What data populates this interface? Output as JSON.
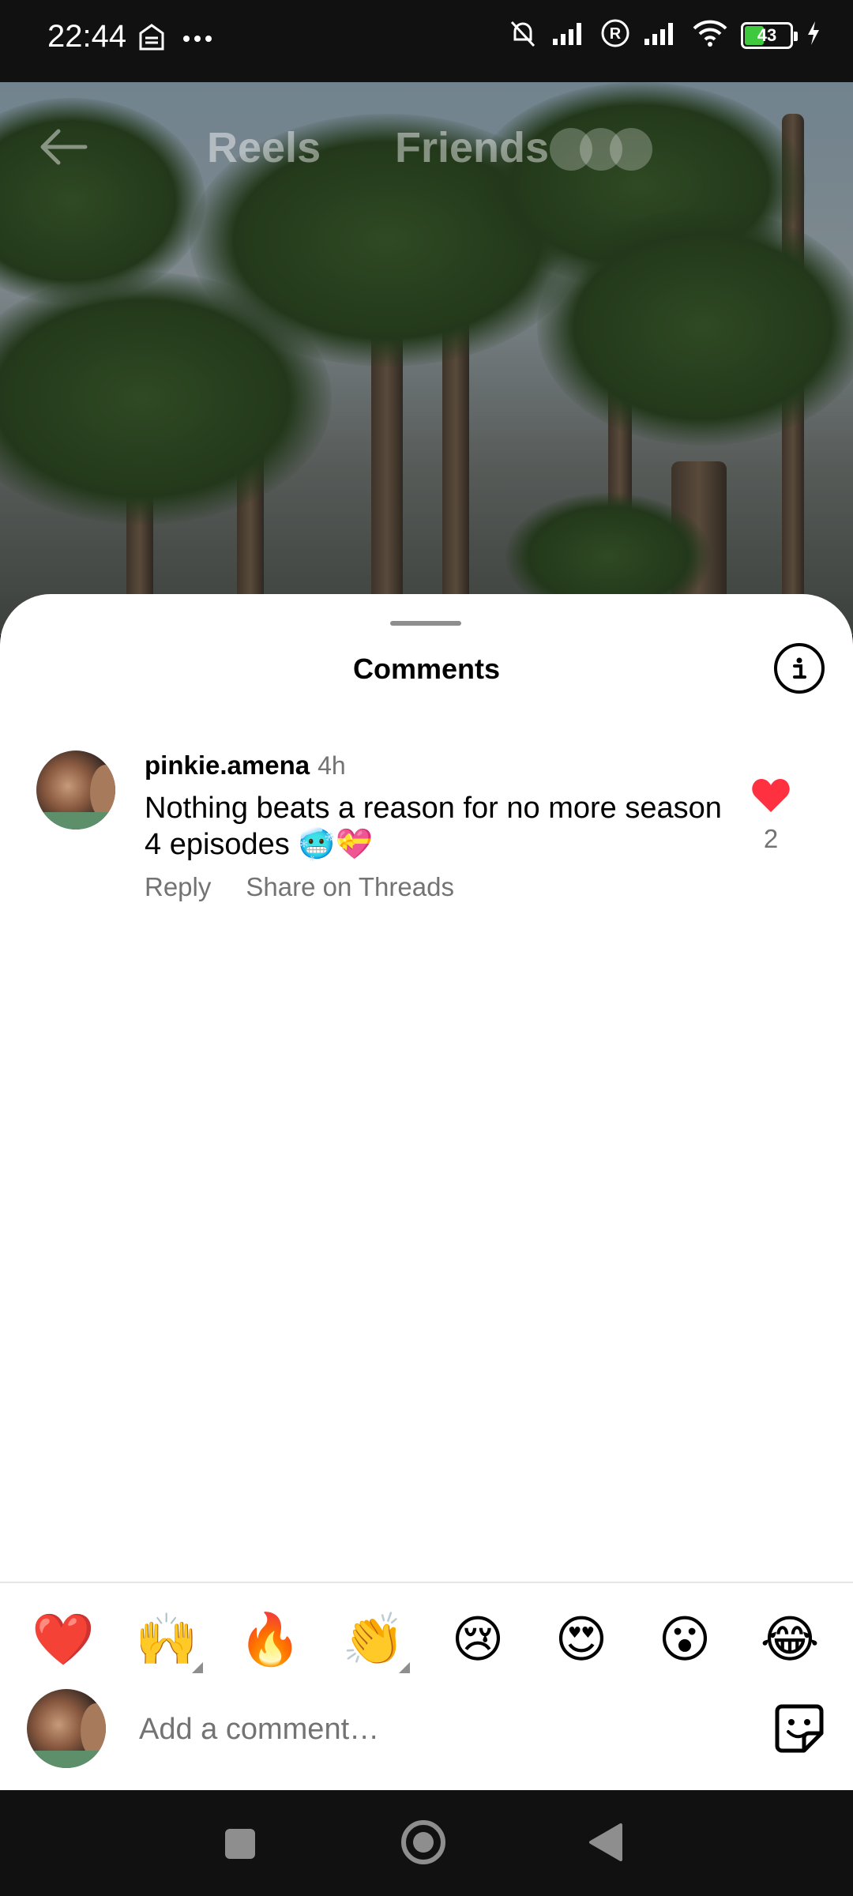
{
  "status_bar": {
    "time": "22:44",
    "battery": "43",
    "icons": [
      "app-notification-icon",
      "more-dots-icon",
      "mute-icon",
      "signal-icon",
      "roaming-icon",
      "signal-icon",
      "wifi-icon",
      "battery-icon",
      "charging-icon"
    ]
  },
  "reel": {
    "tabs": [
      "Reels",
      "Friends"
    ]
  },
  "sheet": {
    "title": "Comments"
  },
  "comments": [
    {
      "username": "pinkie.amena",
      "time": "4h",
      "text": "Nothing beats a reason for no more season 4 episodes 🥶💝",
      "reply_label": "Reply",
      "share_label": "Share on Threads",
      "likes": "2",
      "liked": true
    }
  ],
  "quick_reactions": [
    "❤️",
    "🙌",
    "🔥",
    "👏",
    "😢",
    "😍",
    "😮",
    "😂"
  ],
  "composer": {
    "placeholder": "Add a comment…"
  },
  "colors": {
    "like_red": "#ff3040",
    "secondary_text": "#737373"
  }
}
